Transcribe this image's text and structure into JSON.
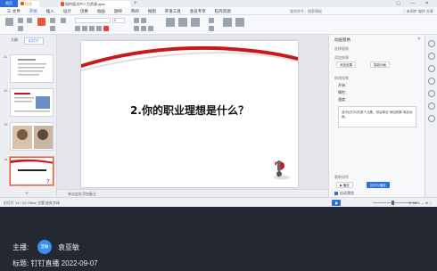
{
  "titlebar": {
    "home_tab": "首页",
    "app_tab": "稻壳",
    "doc_tab": "如何面试中人力资源.pptx",
    "add_tab": "+",
    "window_controls": "▢ — ✕"
  },
  "menubar": {
    "items": [
      "三 文件",
      "开始",
      "插入",
      "设计",
      "切换",
      "动画",
      "放映",
      "审阅",
      "视图",
      "开发工具",
      "会员专享",
      "稻壳资源"
    ],
    "active_index": 1,
    "search": "查找命令、搜索模板",
    "right": "⛶ 未同步 協作 分享"
  },
  "toolbar": {
    "font_name": "",
    "font_size": "0"
  },
  "slides_pane": {
    "tabs": [
      "大纲",
      "幻灯片"
    ],
    "active_tab": 1,
    "slides": [
      {
        "number": "11"
      },
      {
        "number": "12"
      },
      {
        "number": "13"
      },
      {
        "number": "14"
      }
    ],
    "add": "+"
  },
  "slide": {
    "title": "2.你的职业理想是什么？",
    "accent_red": "#c8171e"
  },
  "notes_bar": "单击此处添加备注",
  "taskpane": {
    "title": "动画窗格",
    "close": "✕",
    "select_label": "选择窗格",
    "add_effect": "添加效果",
    "smart_animation": "智能动画",
    "modify_label": "修改效果",
    "start_label": "开始：",
    "property_label": "属性：",
    "speed_label": "速度：",
    "hint": "选中幻灯片的某个元素，然后单击“添加效果”添加动画。",
    "order_label": "重新排序",
    "play_button": "▶ 播放",
    "preview_button": "幻灯片播放",
    "autopreview": "自动预览"
  },
  "statusbar": {
    "left": "幻灯片 14 / 20    Office 主题    缺失字体",
    "right": "⊟ 88% — ⊕ ⛶",
    "zoom_fraction": 0.44
  },
  "overlay": {
    "host_label": "主播:",
    "avatar_text": "亚敏",
    "host_name": "袁亚敏",
    "caption": "标题: 钉钉直播 2022-09-07"
  }
}
